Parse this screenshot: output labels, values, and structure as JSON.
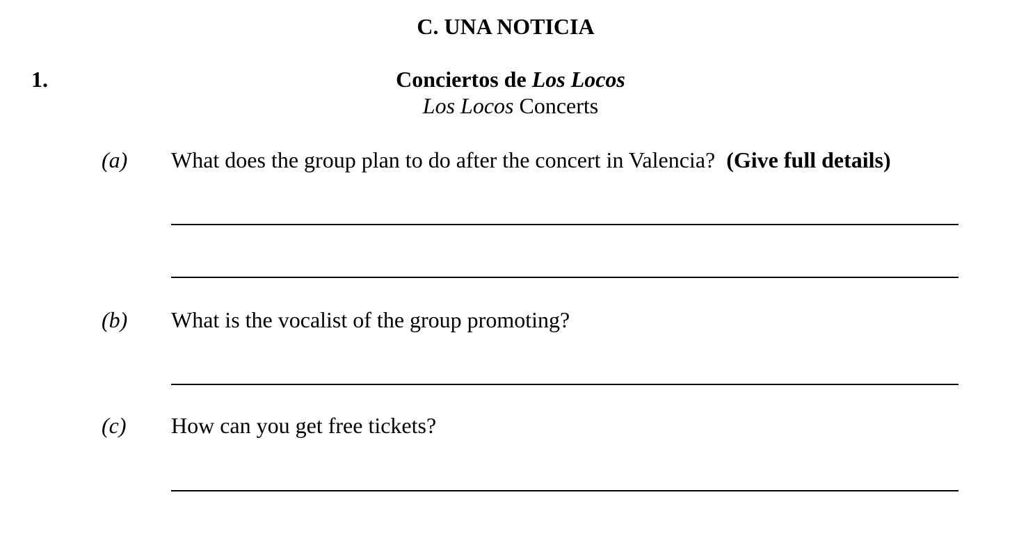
{
  "section": {
    "title": "C. UNA NOTICIA"
  },
  "question": {
    "number": "1.",
    "title_es_bold": "Conciertos de ",
    "title_es_italic": "Los Locos",
    "title_en_italic": "Los Locos",
    "title_en_plain": " Concerts",
    "parts": [
      {
        "label": "(a)",
        "text": "What does the group plan to do after the concert in Valencia?",
        "emphasis": "(Give full details)",
        "answer_lines": 2
      },
      {
        "label": "(b)",
        "text": "What is the vocalist of the group promoting?",
        "answer_lines": 1
      },
      {
        "label": "(c)",
        "text": "How can you get free tickets?",
        "answer_lines": 1
      }
    ]
  }
}
